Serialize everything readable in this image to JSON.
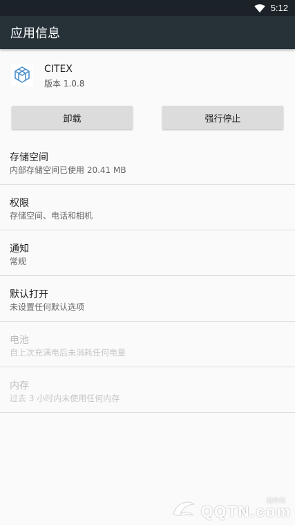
{
  "status_bar": {
    "time": "5:12",
    "wifi_icon": "wifi-icon"
  },
  "app_bar": {
    "title": "应用信息"
  },
  "app": {
    "name": "CITEX",
    "version": "版本 1.0.8",
    "icon": "citex-app-icon"
  },
  "buttons": {
    "uninstall": "卸载",
    "force_stop": "强行停止"
  },
  "settings": [
    {
      "title": "存储空间",
      "summary": "内部存储空间已使用 20.41 MB",
      "enabled": true
    },
    {
      "title": "权限",
      "summary": "存储空间、电话和相机",
      "enabled": true
    },
    {
      "title": "通知",
      "summary": "常规",
      "enabled": true
    },
    {
      "title": "默认打开",
      "summary": "未设置任何默认选项",
      "enabled": true
    },
    {
      "title": "电池",
      "summary": "自上次充满电后未消耗任何电量",
      "enabled": false
    },
    {
      "title": "内存",
      "summary": "过去 3 小时内未使用任何内存",
      "enabled": false
    }
  ],
  "watermark": {
    "text": "QQTN.com",
    "caption": "腾牛网"
  },
  "colors": {
    "app_bar": "#263238",
    "status_bar": "#1c2328",
    "background": "#fafafa",
    "button": "#dcdcdc"
  }
}
